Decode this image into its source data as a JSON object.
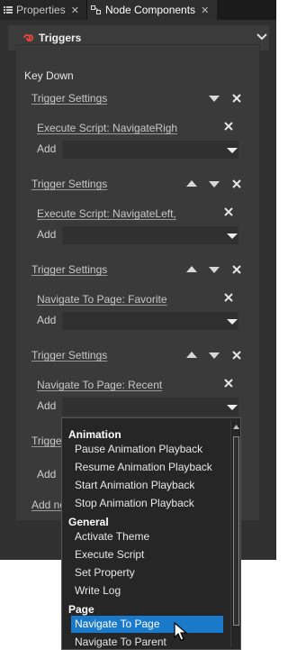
{
  "tabs": [
    {
      "label": "Properties",
      "icon": "properties-icon",
      "close": "✕"
    },
    {
      "label": "Node Components",
      "icon": "node-components-icon",
      "close": "✕"
    }
  ],
  "section": {
    "title": "Triggers",
    "icon": "triggers-icon",
    "collapse_icon": "chevron-down-icon"
  },
  "trigger_event": "Key Down",
  "trigger_settings": [
    {
      "label": "Trigger Settings",
      "action": "Execute Script: NavigateRigh",
      "add_label": "Add"
    },
    {
      "label": "Trigger Settings",
      "action": "Execute Script: NavigateLeft,",
      "add_label": "Add"
    },
    {
      "label": "Trigger Settings",
      "action": "Navigate To Page: Favorite",
      "add_label": "Add"
    },
    {
      "label": "Trigger Settings",
      "action": "Navigate To Page: Recent",
      "add_label": "Add"
    }
  ],
  "partial_trigger_label": "Trigge",
  "partial_add_label": "Add",
  "partial_add_new": "Add ne",
  "colors": {
    "selection": "#1a79c9",
    "panel": "#303030",
    "box": "#3a3a3a"
  },
  "popup": {
    "groups": [
      {
        "name": "Animation",
        "items": [
          "Pause Animation Playback",
          "Resume Animation Playback",
          "Start Animation Playback",
          "Stop Animation Playback"
        ]
      },
      {
        "name": "General",
        "items": [
          "Activate Theme",
          "Execute Script",
          "Set Property",
          "Write Log"
        ]
      },
      {
        "name": "Page",
        "items": [
          "Navigate To Page",
          "Navigate To Parent"
        ]
      }
    ],
    "selected": "Navigate To Page"
  }
}
